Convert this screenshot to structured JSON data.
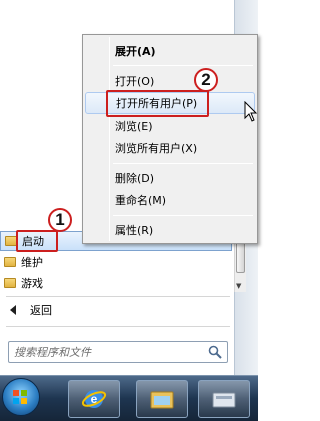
{
  "programs": [
    {
      "label": "启动",
      "selected": true
    },
    {
      "label": "维护",
      "selected": false
    },
    {
      "label": "游戏",
      "selected": false
    }
  ],
  "back_label": "返回",
  "search": {
    "placeholder": "搜索程序和文件"
  },
  "context_menu": {
    "items": [
      {
        "label": "展开(A)",
        "bold": true
      },
      {
        "label": "打开(O)"
      },
      {
        "label": "打开所有用户(P)",
        "hover": true
      },
      {
        "label": "浏览(E)"
      },
      {
        "label": "浏览所有用户(X)"
      },
      {
        "label": "删除(D)"
      },
      {
        "label": "重命名(M)"
      },
      {
        "label": "属性(R)"
      }
    ]
  },
  "callouts": {
    "step1": "1",
    "step2": "2"
  },
  "colors": {
    "callout_red": "#cc1f1f",
    "menu_bg": "#f0f0f0",
    "taskbar": "#1e3550"
  },
  "taskbar": {
    "buttons": [
      "ie-icon",
      "explorer-icon",
      "folder-icon"
    ]
  }
}
